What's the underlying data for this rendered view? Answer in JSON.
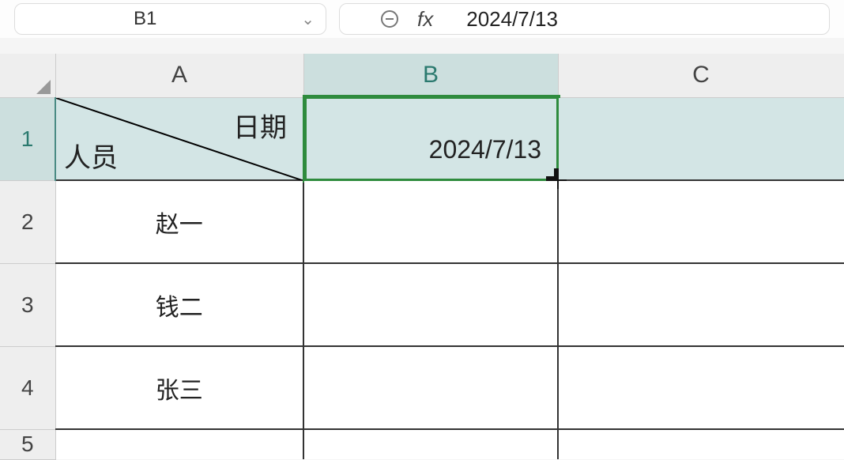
{
  "formula_bar": {
    "name_box": "B1",
    "fx_label": "fx",
    "formula_value": "2024/7/13"
  },
  "columns": [
    "A",
    "B",
    "C"
  ],
  "rows": [
    "1",
    "2",
    "3",
    "4",
    "5"
  ],
  "selected_cell": "B1",
  "cells": {
    "A1": {
      "top": "日期",
      "bottom": "人员"
    },
    "B1": "2024/7/13",
    "A2": "赵一",
    "A3": "钱二",
    "A4": "张三"
  }
}
